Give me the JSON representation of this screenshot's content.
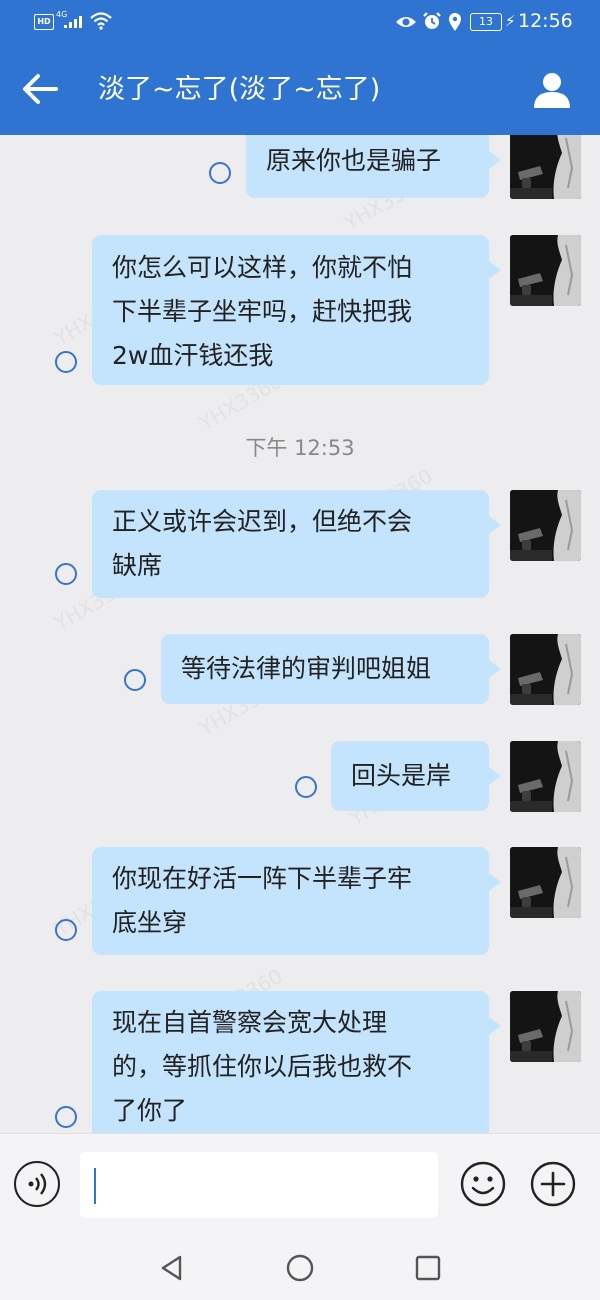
{
  "status_bar": {
    "hd": "HD",
    "network": "4G",
    "battery": "13",
    "time": "12:56"
  },
  "header": {
    "title": "淡了~忘了(淡了~忘了)"
  },
  "chat": {
    "watermark": "YHX3360",
    "timestamp": "下午 12:53",
    "messages": [
      {
        "lines": [
          "原来你也是骗子"
        ]
      },
      {
        "lines": [
          "你怎么可以这样，你就不怕",
          "下半辈子坐牢吗，赶快把我",
          "2w血汗钱还我"
        ]
      },
      {
        "lines": [
          "正义或许会迟到，但绝不会",
          "缺席"
        ]
      },
      {
        "lines": [
          "等待法律的审判吧姐姐"
        ]
      },
      {
        "lines": [
          "回头是岸"
        ]
      },
      {
        "lines": [
          "你现在好活一阵下半辈子牢",
          "底坐穿"
        ]
      },
      {
        "lines": [
          "现在自首警察会宽大处理",
          "的，等抓住你以后我也救不",
          "了你了"
        ]
      }
    ]
  },
  "input": {
    "placeholder": ""
  },
  "colors": {
    "header_bg": "#2f74d0",
    "bubble_bg": "#c4e3fd",
    "status_ring": "#3974c7",
    "chat_bg": "#ededf0"
  }
}
